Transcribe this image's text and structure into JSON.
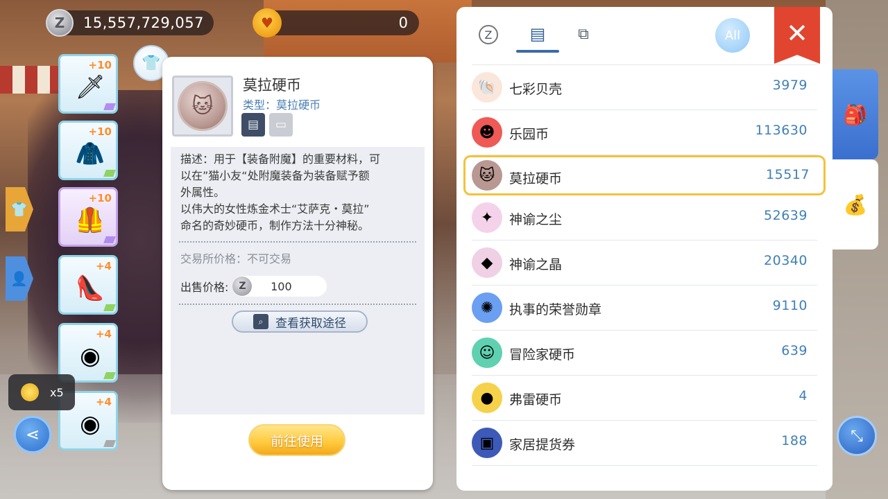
{
  "top_bar": {
    "zeny_value": "15,557,729,057",
    "zeny_icon": "Z",
    "cat_coin_value": "0",
    "cat_coin_icon": "cat-coin-icon"
  },
  "equipment": [
    {
      "level": "+10",
      "icon": "🗡",
      "style": "blue",
      "corner": "purple"
    },
    {
      "level": "+10",
      "icon": "🧥",
      "style": "blue",
      "corner": "green"
    },
    {
      "level": "+10",
      "icon": "🦺",
      "style": "purple",
      "corner": "purple"
    },
    {
      "level": "+4",
      "icon": "👠",
      "style": "blue",
      "corner": "green"
    },
    {
      "level": "+4",
      "icon": "◉",
      "style": "blue",
      "corner": "green"
    },
    {
      "level": "+4",
      "icon": "◉",
      "style": "blue",
      "corner": "gray"
    }
  ],
  "gold_badge": {
    "count": "x5"
  },
  "detail": {
    "name": "莫拉硬币",
    "type": "类型：莫拉硬币",
    "description": [
      "描述：用于【装备附魔】的重要材料，可",
      "以在”猫小友“处附魔装备为装备赋予额",
      "外属性。",
      "以伟大的女性炼金术士“艾萨克・莫拉”",
      "命名的奇妙硬币，制作方法十分神秘。"
    ],
    "trade_price": "交易所价格：不可交易",
    "sell_label": "出售价格:",
    "sell_value": "100",
    "get_route_label": "查看获取途径",
    "use_label": "前往使用"
  },
  "inventory": {
    "all_label": "All",
    "close_label": "✕",
    "items": [
      {
        "name": "七彩贝壳",
        "value": "3979",
        "icon": "🐚",
        "bg": "#fbe6dc",
        "selected": false
      },
      {
        "name": "乐园币",
        "value": "113630",
        "icon": "☻",
        "bg": "#ef5a56",
        "selected": false
      },
      {
        "name": "莫拉硬币",
        "value": "15517",
        "icon": "🐱",
        "bg": "#b99892",
        "selected": true
      },
      {
        "name": "神谕之尘",
        "value": "52639",
        "icon": "✦",
        "bg": "#f4d3ea",
        "selected": false
      },
      {
        "name": "神谕之晶",
        "value": "20340",
        "icon": "◆",
        "bg": "#f0d0e4",
        "selected": false
      },
      {
        "name": "执事的荣誉勋章",
        "value": "9110",
        "icon": "✺",
        "bg": "#6a9ff1",
        "selected": false
      },
      {
        "name": "冒险家硬币",
        "value": "639",
        "icon": "☺",
        "bg": "#5fd1b0",
        "selected": false
      },
      {
        "name": "弗雷硬币",
        "value": "4",
        "icon": "●",
        "bg": "#f6d14a",
        "selected": false
      },
      {
        "name": "家居提货券",
        "value": "188",
        "icon": "▣",
        "bg": "#3e5ab8",
        "selected": false
      }
    ]
  },
  "colors": {
    "accent_blue": "#3b6fce",
    "value_blue": "#3f7fb8",
    "select_gold": "#f3c23b",
    "close_red": "#e2452f"
  }
}
